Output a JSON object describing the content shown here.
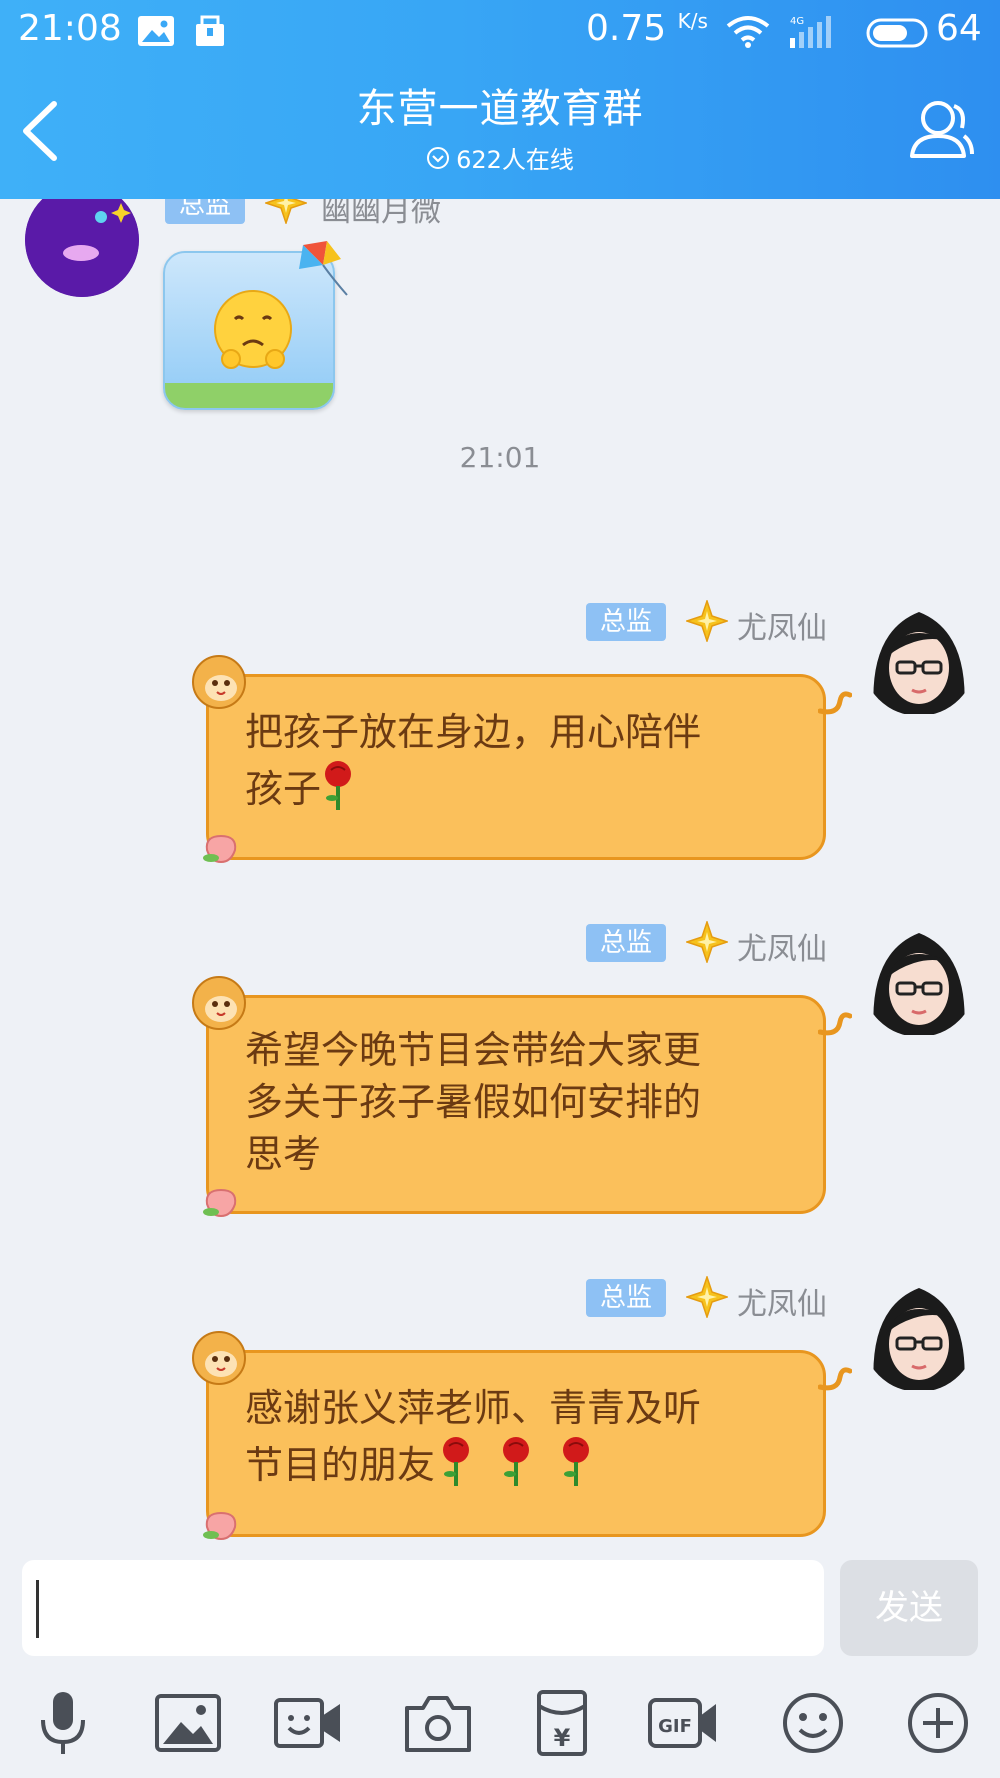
{
  "status_bar": {
    "time": "21:08",
    "speed_value": "0.75",
    "speed_unit": "K/s",
    "network": "4G",
    "battery": "64"
  },
  "header": {
    "title": "东营一道教育群",
    "online_text": "622人在线"
  },
  "messages": [
    {
      "role_tag": "总监",
      "sender": "幽幽月微",
      "type": "sticker"
    },
    {
      "timestamp": "21:01"
    },
    {
      "role_tag": "总监",
      "sender": "尤凤仙",
      "text_line1": "把孩子放在身边，用心陪伴",
      "text_line2": "孩子"
    },
    {
      "role_tag": "总监",
      "sender": "尤凤仙",
      "text_line1": "希望今晚节目会带给大家更",
      "text_line2": "多关于孩子暑假如何安排的",
      "text_line3": "思考"
    },
    {
      "role_tag": "总监",
      "sender": "尤凤仙",
      "text_line1": "感谢张义萍老师、青青及听",
      "text_line2": "节目的朋友"
    }
  ],
  "input": {
    "value": "",
    "send_label": "发送"
  },
  "toolbar": [
    "microphone-icon",
    "image-icon",
    "video-call-icon",
    "camera-icon",
    "red-packet-icon",
    "gif-icon",
    "emoji-icon",
    "plus-icon"
  ],
  "colors": {
    "header_gradient_start": "#3fb0f8",
    "header_gradient_end": "#2e8ff0",
    "bubble_fill": "#fbc05b",
    "bubble_border": "#e8961f",
    "bubble_text": "#6b3a12",
    "role_tag": "#8ec1f4",
    "background": "#eef1f6"
  }
}
